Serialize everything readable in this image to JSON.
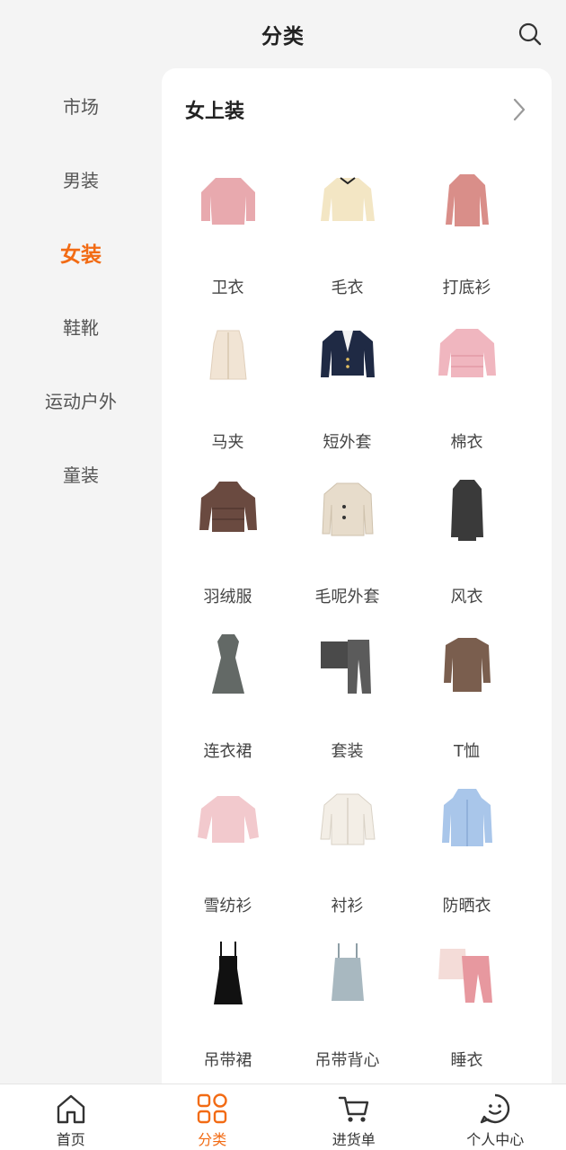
{
  "header": {
    "title": "分类",
    "search_icon": "search-icon"
  },
  "sidebar": {
    "items": [
      {
        "label": "市场",
        "active": false
      },
      {
        "label": "男装",
        "active": false
      },
      {
        "label": "女装",
        "active": true
      },
      {
        "label": "鞋靴",
        "active": false
      },
      {
        "label": "运动户外",
        "active": false
      },
      {
        "label": "童装",
        "active": false
      }
    ]
  },
  "section": {
    "title": "女上装",
    "items": [
      {
        "label": "卫衣",
        "icon": "sweatshirt-icon",
        "color": "#e8a9ae"
      },
      {
        "label": "毛衣",
        "icon": "sweater-icon",
        "color": "#f3e6c4"
      },
      {
        "label": "打底衫",
        "icon": "base-shirt-icon",
        "color": "#d98e89"
      },
      {
        "label": "马夹",
        "icon": "vest-icon",
        "color": "#f1e4d4"
      },
      {
        "label": "短外套",
        "icon": "short-jacket-icon",
        "color": "#1f2a44"
      },
      {
        "label": "棉衣",
        "icon": "padded-coat-icon",
        "color": "#f0b6bf"
      },
      {
        "label": "羽绒服",
        "icon": "down-jacket-icon",
        "color": "#6a4a40"
      },
      {
        "label": "毛呢外套",
        "icon": "wool-coat-icon",
        "color": "#e7dccb"
      },
      {
        "label": "风衣",
        "icon": "trench-coat-icon",
        "color": "#3a3a3a"
      },
      {
        "label": "连衣裙",
        "icon": "dress-icon",
        "color": "#636966"
      },
      {
        "label": "套装",
        "icon": "suit-set-icon",
        "color": "#4a4a4a"
      },
      {
        "label": "T恤",
        "icon": "tshirt-icon",
        "color": "#7a5e4e"
      },
      {
        "label": "雪纺衫",
        "icon": "chiffon-blouse-icon",
        "color": "#f2c9cd"
      },
      {
        "label": "衬衫",
        "icon": "shirt-icon",
        "color": "#f3eee6"
      },
      {
        "label": "防晒衣",
        "icon": "sun-protection-icon",
        "color": "#a9c6ea"
      },
      {
        "label": "吊带裙",
        "icon": "slip-dress-icon",
        "color": "#111111"
      },
      {
        "label": "吊带背心",
        "icon": "camisole-icon",
        "color": "#a8b8c0"
      },
      {
        "label": "睡衣",
        "icon": "pajamas-icon",
        "color": "#e7989f"
      }
    ]
  },
  "tabbar": {
    "tabs": [
      {
        "label": "首页",
        "icon": "home-icon",
        "active": false
      },
      {
        "label": "分类",
        "icon": "category-icon",
        "active": true
      },
      {
        "label": "进货单",
        "icon": "cart-icon",
        "active": false
      },
      {
        "label": "个人中心",
        "icon": "profile-icon",
        "active": false
      }
    ]
  },
  "colors": {
    "accent": "#f26b14",
    "background": "#f4f4f4",
    "panel": "#ffffff"
  }
}
